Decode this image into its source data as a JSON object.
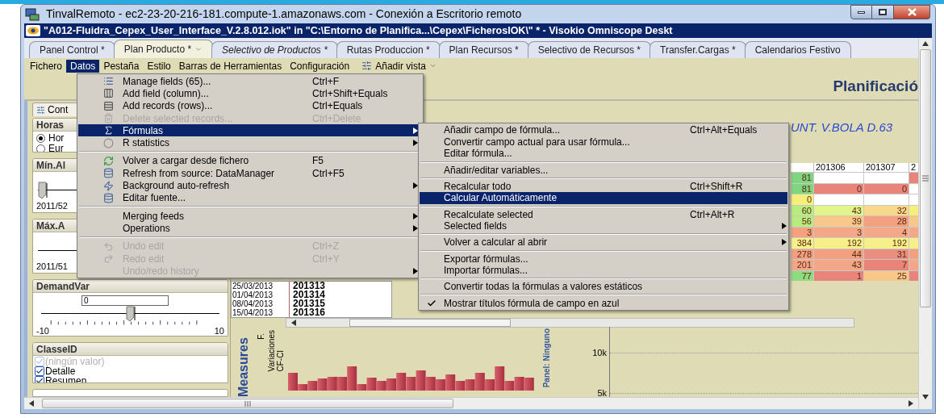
{
  "remote_window": {
    "title": "TinvalRemoto - ec2-23-20-216-181.compute-1.amazonaws.com - Conexión a Escritorio remoto"
  },
  "app_title": "\"A012-Fluidra_Cepex_User_Interface_V.2.8.012.iok\" in \"C:\\Entorno de Planifica...\\Cepex\\FicherosIOK\\\" * - Visokio Omniscope Deskt",
  "tabs": [
    {
      "label": "Panel Control *",
      "selected": false,
      "italic": false
    },
    {
      "label": "Plan Producto *",
      "selected": true,
      "italic": false
    },
    {
      "label": "Selectivo de Productos *",
      "selected": false,
      "italic": true
    },
    {
      "label": "Rutas Produccion *",
      "selected": false,
      "italic": false
    },
    {
      "label": "Plan Recursos *",
      "selected": false,
      "italic": false
    },
    {
      "label": "Selectivo de Recursos *",
      "selected": false,
      "italic": false
    },
    {
      "label": "Transfer.Cargas *",
      "selected": false,
      "italic": false
    },
    {
      "label": "Calendarios Festivo",
      "selected": false,
      "italic": false
    }
  ],
  "menu_bar": [
    {
      "label": "Fichero",
      "selected": false
    },
    {
      "label": "Datos",
      "selected": true
    },
    {
      "label": "Pestaña",
      "selected": false
    },
    {
      "label": "Estilo",
      "selected": false
    },
    {
      "label": "Barras de Herramientas",
      "selected": false
    },
    {
      "label": "Configuración",
      "selected": false
    }
  ],
  "add_view": "Añadir vista",
  "heading": "Planificació",
  "sidebar_tab": "Cont",
  "filters": [
    {
      "kind": "radio",
      "title": "Horas",
      "options": [
        {
          "label": "Hor",
          "selected": true
        },
        {
          "label": "Eur",
          "selected": false
        }
      ]
    },
    {
      "kind": "range",
      "title": "Mín.Al",
      "value": "2011/52",
      "level": 0
    },
    {
      "kind": "range",
      "title": "Máx.A",
      "value": "2011/51"
    },
    {
      "kind": "slider",
      "title": "DemandVar",
      "value": "0",
      "level": 0.5,
      "min": "-10",
      "max": "10"
    },
    {
      "kind": "checklist",
      "title": "ClasseID",
      "options": [
        {
          "label": "(ningún valor)",
          "checked": true,
          "disabled": true
        },
        {
          "label": "Detalle",
          "checked": true,
          "disabled": false
        },
        {
          "label": "Resumen",
          "checked": true,
          "disabled": false
        }
      ]
    }
  ],
  "view_title": "UNT. V.BOLA D.63",
  "heat_table": {
    "columns": [
      "201306",
      "201307",
      "2"
    ],
    "rows": [
      {
        "cells": [
          {
            "text": "81",
            "color": "#7fd67f"
          },
          {
            "color": "#ffffff"
          },
          {
            "color": "#ffffff"
          },
          {
            "color": "#e8847a"
          }
        ]
      },
      {
        "cells": [
          {
            "text": "81",
            "color": "#7fd67f"
          },
          {
            "text": "0",
            "color": "#e8847a"
          },
          {
            "text": "0",
            "color": "#e8847a"
          },
          {
            "color": "#ffffff"
          }
        ]
      },
      {
        "cells": [
          {
            "text": "0",
            "color": "#f5f07a"
          },
          {
            "color": "#ffffff"
          },
          {
            "color": "#ffffff"
          },
          {
            "color": "#ffffff"
          }
        ]
      },
      {
        "cells": [
          {
            "text": "60",
            "color": "#b8ec7f"
          },
          {
            "text": "43",
            "color": "#e2f58a"
          },
          {
            "text": "32",
            "color": "#f8d88a"
          },
          {
            "color": "#f5f07a"
          }
        ]
      },
      {
        "cells": [
          {
            "text": "56",
            "color": "#b8ec7f"
          },
          {
            "text": "39",
            "color": "#f8c88a"
          },
          {
            "text": "28",
            "color": "#f2a07f"
          },
          {
            "color": "#f8c88a"
          }
        ]
      },
      {
        "cells": [
          {
            "text": "3",
            "color": "#f5a07f"
          },
          {
            "text": "3",
            "color": "#f5a888"
          },
          {
            "text": "4",
            "color": "#f5a888"
          },
          {
            "color": "#f5a888"
          }
        ]
      },
      {
        "cells": [
          {
            "text": "384",
            "color": "#f5f08a"
          },
          {
            "text": "192",
            "color": "#f5f08a"
          },
          {
            "text": "192",
            "color": "#f5f08a"
          },
          {
            "color": "#f5f08a"
          }
        ]
      },
      {
        "cells": [
          {
            "text": "278",
            "color": "#f2a07f"
          },
          {
            "text": "44",
            "color": "#f2a07f"
          },
          {
            "text": "31",
            "color": "#ea8e80"
          },
          {
            "color": "#f2a07f"
          }
        ]
      },
      {
        "cells": [
          {
            "text": "201",
            "color": "#f2a888"
          },
          {
            "text": "43",
            "color": "#f2a888"
          },
          {
            "text": "7",
            "color": "#e8847a"
          },
          {
            "color": "#f2a888"
          }
        ]
      },
      {
        "cells": [
          {
            "text": "77",
            "color": "#8fdc80"
          },
          {
            "text": "1",
            "color": "#e8847a"
          },
          {
            "text": "25",
            "color": "#f8c88a"
          },
          {
            "color": "#e8847a"
          }
        ]
      }
    ]
  },
  "week_table": {
    "rows": [
      {
        "date": "25/03/2013",
        "week": "201313"
      },
      {
        "date": "01/04/2013",
        "week": "201314"
      },
      {
        "date": "08/04/2013",
        "week": "201315"
      },
      {
        "date": "15/04/2013",
        "week": "201316"
      }
    ]
  },
  "measures_chart": {
    "title": "Measures",
    "labels": [
      "F.",
      "Variaciones",
      "CF-CI"
    ]
  },
  "panel_chart": {
    "title": "Panel: Ninguno",
    "axis_labels": [
      "10k",
      "5k"
    ]
  },
  "datos_menu": [
    {
      "kind": "item",
      "label": "Manage fields (65)...",
      "shortcut": "Ctrl+F",
      "disabled": false,
      "selected": false,
      "submenu": false
    },
    {
      "kind": "item",
      "label": "Add field (column)...",
      "shortcut": "Ctrl+Shift+Equals",
      "disabled": false,
      "selected": false,
      "submenu": false
    },
    {
      "kind": "item",
      "label": "Add records (rows)...",
      "shortcut": "Ctrl+Equals",
      "disabled": false,
      "selected": false,
      "submenu": false
    },
    {
      "kind": "item",
      "label": "Delete selected records...",
      "shortcut": "Ctrl+Delete",
      "disabled": true,
      "selected": false,
      "submenu": false
    },
    {
      "kind": "item",
      "label": "Fórmulas",
      "disabled": false,
      "selected": true,
      "submenu": true
    },
    {
      "kind": "item",
      "label": "R statistics",
      "disabled": false,
      "selected": false,
      "submenu": true
    },
    {
      "kind": "separator"
    },
    {
      "kind": "item",
      "label": "Volver a cargar desde fichero",
      "shortcut": "F5",
      "disabled": false,
      "selected": false,
      "submenu": false
    },
    {
      "kind": "item",
      "label": "Refresh from source: DataManager",
      "shortcut": "Ctrl+F5",
      "disabled": false,
      "selected": false,
      "submenu": false
    },
    {
      "kind": "item",
      "label": "Background auto-refresh",
      "disabled": false,
      "selected": false,
      "submenu": true
    },
    {
      "kind": "item",
      "label": "Editar fuente...",
      "disabled": false,
      "selected": false,
      "submenu": false
    },
    {
      "kind": "separator"
    },
    {
      "kind": "item",
      "label": "Merging feeds",
      "disabled": false,
      "selected": false,
      "submenu": true
    },
    {
      "kind": "item",
      "label": "Operations",
      "disabled": false,
      "selected": false,
      "submenu": true
    },
    {
      "kind": "separator"
    },
    {
      "kind": "item",
      "label": "Undo edit",
      "shortcut": "Ctrl+Z",
      "disabled": true,
      "selected": false,
      "submenu": false
    },
    {
      "kind": "item",
      "label": "Redo edit",
      "shortcut": "Ctrl+Y",
      "disabled": true,
      "selected": false,
      "submenu": false
    },
    {
      "kind": "item",
      "label": "Undo/redo history",
      "disabled": true,
      "selected": false,
      "submenu": true
    }
  ],
  "formulas_submenu": [
    {
      "kind": "item",
      "label": "Añadir campo de fórmula...",
      "shortcut": "Ctrl+Alt+Equals",
      "selected": false,
      "submenu": false,
      "checked": false
    },
    {
      "kind": "item",
      "label": "Convertir campo actual para usar fórmula...",
      "selected": false,
      "submenu": false,
      "checked": false
    },
    {
      "kind": "item",
      "label": "Editar fórmula...",
      "selected": false,
      "submenu": false,
      "checked": false
    },
    {
      "kind": "separator"
    },
    {
      "kind": "item",
      "label": "Añadir/editar variables...",
      "selected": false,
      "submenu": false,
      "checked": false
    },
    {
      "kind": "separator"
    },
    {
      "kind": "item",
      "label": "Recalcular todo",
      "shortcut": "Ctrl+Shift+R",
      "selected": false,
      "submenu": false,
      "checked": false
    },
    {
      "kind": "item",
      "label": "Calcular Automáticamente",
      "selected": true,
      "submenu": false,
      "checked": false
    },
    {
      "kind": "separator"
    },
    {
      "kind": "item",
      "label": "Recalculate selected",
      "shortcut": "Ctrl+Alt+R",
      "selected": false,
      "submenu": false,
      "checked": false
    },
    {
      "kind": "item",
      "label": "Selected fields",
      "selected": false,
      "submenu": true,
      "checked": false
    },
    {
      "kind": "separator"
    },
    {
      "kind": "item",
      "label": "Volver a calcular al abrir",
      "selected": false,
      "submenu": true,
      "checked": false
    },
    {
      "kind": "separator"
    },
    {
      "kind": "item",
      "label": "Exportar fórmulas...",
      "selected": false,
      "submenu": false,
      "checked": false
    },
    {
      "kind": "item",
      "label": "Importar fórmulas...",
      "selected": false,
      "submenu": false,
      "checked": false
    },
    {
      "kind": "separator"
    },
    {
      "kind": "item",
      "label": "Convertir todas la fórmulas a valores estáticos",
      "selected": false,
      "submenu": false,
      "checked": false
    },
    {
      "kind": "separator"
    },
    {
      "kind": "item",
      "label": "Mostrar títulos fórmula de campo en azul",
      "selected": false,
      "submenu": false,
      "checked": true
    }
  ]
}
